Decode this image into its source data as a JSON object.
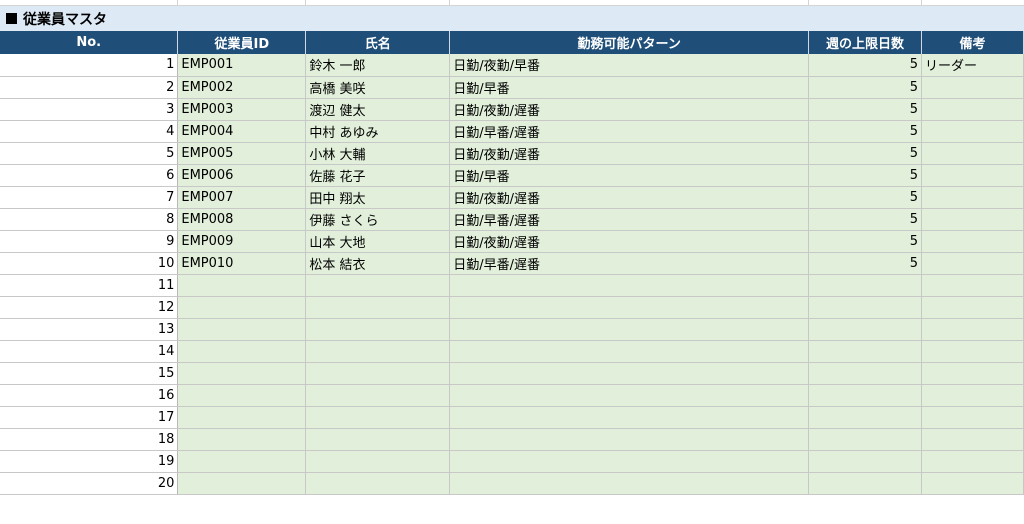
{
  "sheet_title": "従業員マスタ",
  "columns": [
    "No.",
    "従業員ID",
    "氏名",
    "勤務可能パターン",
    "週の上限日数",
    "備考"
  ],
  "rows": [
    {
      "no": "1",
      "id": "EMP001",
      "name": "鈴木 一郎",
      "pattern": "日勤/夜勤/早番",
      "limit": "5",
      "note": "リーダー"
    },
    {
      "no": "2",
      "id": "EMP002",
      "name": "高橋 美咲",
      "pattern": "日勤/早番",
      "limit": "5",
      "note": ""
    },
    {
      "no": "3",
      "id": "EMP003",
      "name": "渡辺 健太",
      "pattern": "日勤/夜勤/遅番",
      "limit": "5",
      "note": ""
    },
    {
      "no": "4",
      "id": "EMP004",
      "name": "中村 あゆみ",
      "pattern": "日勤/早番/遅番",
      "limit": "5",
      "note": ""
    },
    {
      "no": "5",
      "id": "EMP005",
      "name": "小林 大輔",
      "pattern": "日勤/夜勤/遅番",
      "limit": "5",
      "note": ""
    },
    {
      "no": "6",
      "id": "EMP006",
      "name": "佐藤 花子",
      "pattern": "日勤/早番",
      "limit": "5",
      "note": ""
    },
    {
      "no": "7",
      "id": "EMP007",
      "name": "田中 翔太",
      "pattern": "日勤/夜勤/遅番",
      "limit": "5",
      "note": ""
    },
    {
      "no": "8",
      "id": "EMP008",
      "name": "伊藤 さくら",
      "pattern": "日勤/早番/遅番",
      "limit": "5",
      "note": ""
    },
    {
      "no": "9",
      "id": "EMP009",
      "name": "山本 大地",
      "pattern": "日勤/夜勤/遅番",
      "limit": "5",
      "note": ""
    },
    {
      "no": "10",
      "id": "EMP010",
      "name": "松本 結衣",
      "pattern": "日勤/早番/遅番",
      "limit": "5",
      "note": ""
    },
    {
      "no": "11",
      "id": "",
      "name": "",
      "pattern": "",
      "limit": "",
      "note": ""
    },
    {
      "no": "12",
      "id": "",
      "name": "",
      "pattern": "",
      "limit": "",
      "note": ""
    },
    {
      "no": "13",
      "id": "",
      "name": "",
      "pattern": "",
      "limit": "",
      "note": ""
    },
    {
      "no": "14",
      "id": "",
      "name": "",
      "pattern": "",
      "limit": "",
      "note": ""
    },
    {
      "no": "15",
      "id": "",
      "name": "",
      "pattern": "",
      "limit": "",
      "note": ""
    },
    {
      "no": "16",
      "id": "",
      "name": "",
      "pattern": "",
      "limit": "",
      "note": ""
    },
    {
      "no": "17",
      "id": "",
      "name": "",
      "pattern": "",
      "limit": "",
      "note": ""
    },
    {
      "no": "18",
      "id": "",
      "name": "",
      "pattern": "",
      "limit": "",
      "note": ""
    },
    {
      "no": "19",
      "id": "",
      "name": "",
      "pattern": "",
      "limit": "",
      "note": ""
    },
    {
      "no": "20",
      "id": "",
      "name": "",
      "pattern": "",
      "limit": "",
      "note": ""
    }
  ],
  "colors": {
    "header_bg": "#1f4e79",
    "title_bg": "#dde9f5",
    "cell_bg": "#e2efda"
  }
}
